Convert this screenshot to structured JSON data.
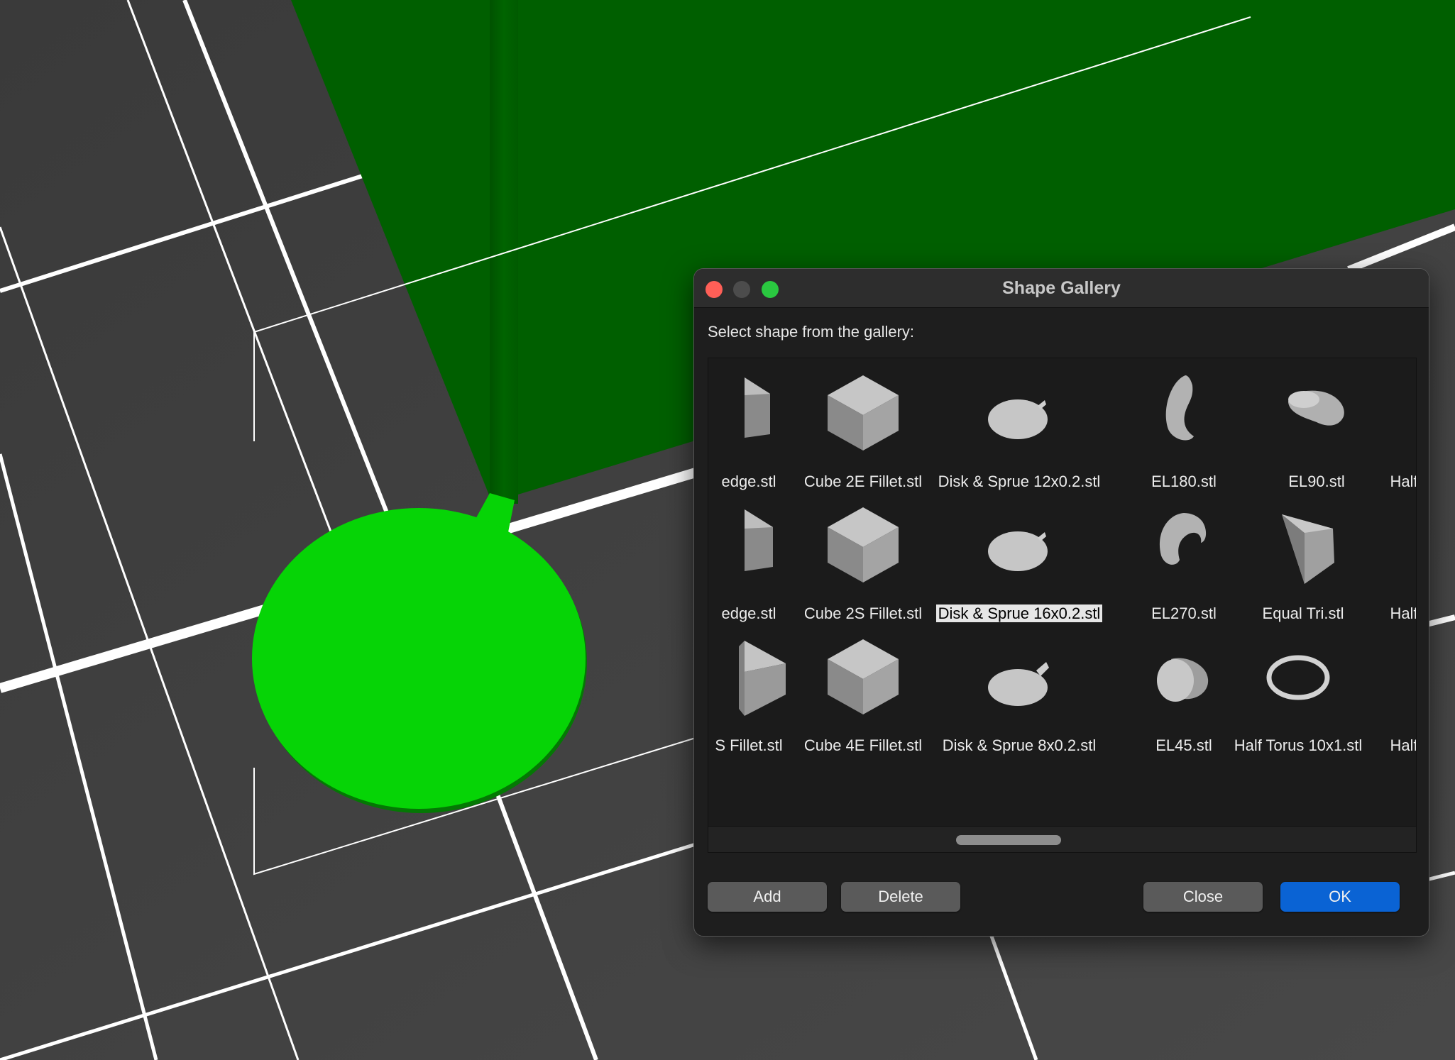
{
  "dialog": {
    "title": "Shape Gallery",
    "prompt": "Select shape from the gallery:",
    "buttons": {
      "add": "Add",
      "delete": "Delete",
      "close": "Close",
      "ok": "OK"
    },
    "rows": [
      [
        "edge.stl",
        "Cube 2E Fillet.stl",
        "Disk & Sprue 12x0.2.stl",
        "EL180.stl",
        "EL90.stl",
        "Half"
      ],
      [
        "edge.stl",
        "Cube 2S Fillet.stl",
        "Disk & Sprue 16x0.2.stl",
        "EL270.stl",
        "Equal Tri.stl",
        "Half"
      ],
      [
        "S Fillet.stl",
        "Cube 4E Fillet.stl",
        "Disk & Sprue 8x0.2.stl",
        "EL45.stl",
        "Half Torus 10x1.stl",
        "Half"
      ]
    ],
    "selected": "Disk & Sprue 16x0.2.stl"
  },
  "colors": {
    "plate": "#3d3d3d",
    "model_dark": "#005f00",
    "model_bright": "#06d406",
    "ok_button": "#0a63d4"
  }
}
